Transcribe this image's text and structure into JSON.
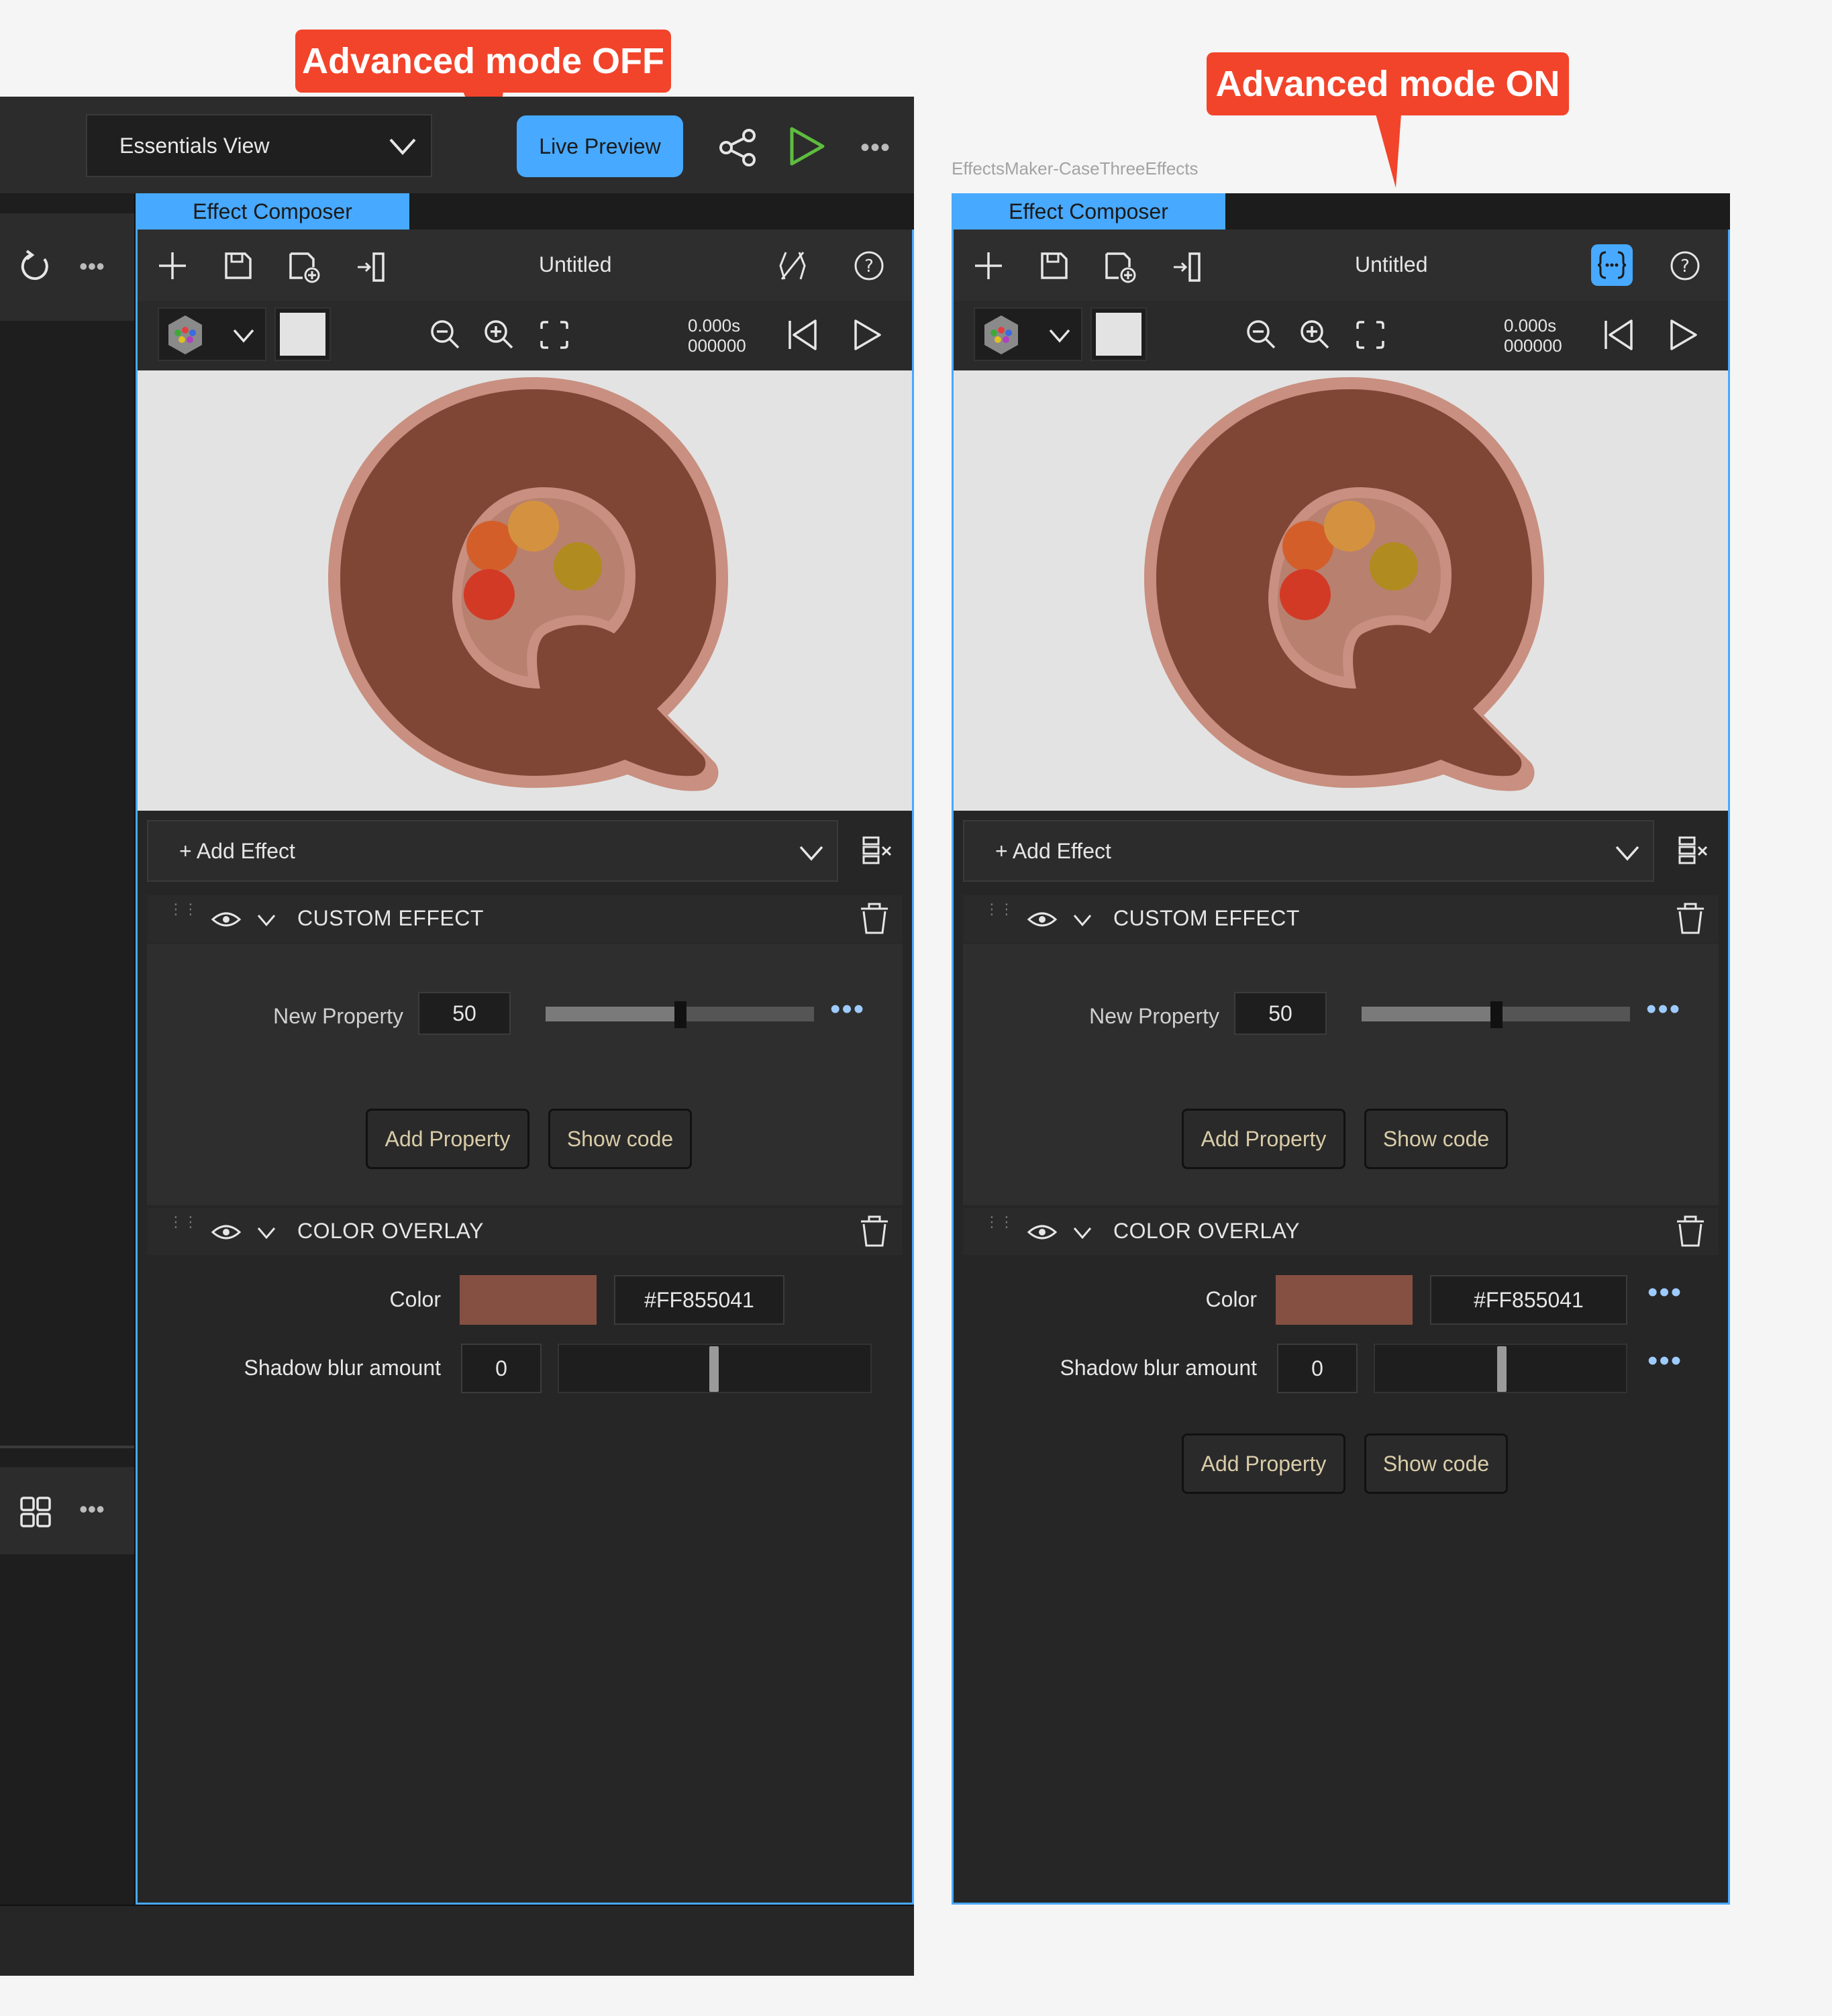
{
  "callouts": {
    "off": "Advanced mode OFF",
    "on": "Advanced mode ON"
  },
  "toolbar": {
    "view_select": "Essentials View",
    "live_preview": "Live Preview"
  },
  "window_label": "EffectsMaker-CaseThreeEffects",
  "panels": [
    {
      "tab": "Effect Composer",
      "title": "Untitled",
      "time": "0.000s",
      "frame": "000000",
      "add_effect": "+ Add Effect",
      "custom_effect": {
        "title": "CUSTOM EFFECT",
        "prop_label": "New Property",
        "prop_value": "50",
        "slider_fraction": 0.5,
        "add_property": "Add Property",
        "show_code": "Show code"
      },
      "color_overlay": {
        "title": "COLOR OVERLAY",
        "color_label": "Color",
        "color_hex": "#FF855041",
        "swatch_color": "#855041",
        "blur_label": "Shadow blur amount",
        "blur_value": "0"
      }
    },
    {
      "tab": "Effect Composer",
      "title": "Untitled",
      "time": "0.000s",
      "frame": "000000",
      "add_effect": "+ Add Effect",
      "custom_effect": {
        "title": "CUSTOM EFFECT",
        "prop_label": "New Property",
        "prop_value": "50",
        "slider_fraction": 0.5,
        "add_property": "Add Property",
        "show_code": "Show code"
      },
      "color_overlay": {
        "title": "COLOR OVERLAY",
        "color_label": "Color",
        "color_hex": "#FF855041",
        "swatch_color": "#855041",
        "blur_label": "Shadow blur amount",
        "blur_value": "0",
        "add_property": "Add Property",
        "show_code": "Show code"
      }
    }
  ],
  "colors": {
    "accent": "#47a9ff",
    "callout": "#f2442b",
    "panel_bg": "#262626"
  }
}
